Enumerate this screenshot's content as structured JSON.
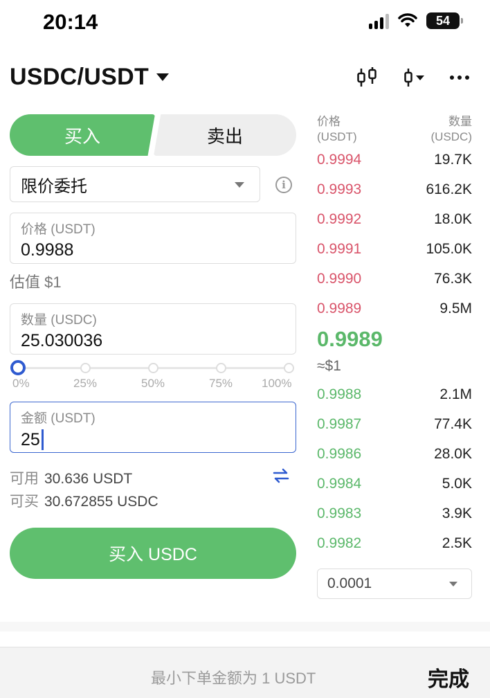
{
  "status_bar": {
    "time": "20:14",
    "battery": "54"
  },
  "header": {
    "pair": "USDC/USDT"
  },
  "tabs": {
    "buy": "买入",
    "sell": "卖出"
  },
  "order_type": {
    "value": "限价委托"
  },
  "price_field": {
    "label": "价格 (USDT)",
    "value": "0.9988",
    "estimate": "估值 $1"
  },
  "qty_field": {
    "label": "数量 (USDC)",
    "value": "25.030036"
  },
  "slider": {
    "value_percent": 0,
    "labels": [
      "0%",
      "25%",
      "50%",
      "75%",
      "100%"
    ]
  },
  "amount_field": {
    "label": "金额 (USDT)",
    "value": "25"
  },
  "available": {
    "usable_label": "可用",
    "usable_value": "30.636 USDT",
    "buyable_label": "可买",
    "buyable_value": "30.672855 USDC"
  },
  "buy_button": {
    "label": "买入 USDC"
  },
  "orderbook": {
    "price_header": "价格",
    "price_unit": "(USDT)",
    "qty_header": "数量",
    "qty_unit": "(USDC)",
    "asks": [
      {
        "price": "0.9994",
        "qty": "19.7K"
      },
      {
        "price": "0.9993",
        "qty": "616.2K"
      },
      {
        "price": "0.9992",
        "qty": "18.0K"
      },
      {
        "price": "0.9991",
        "qty": "105.0K"
      },
      {
        "price": "0.9990",
        "qty": "76.3K"
      },
      {
        "price": "0.9989",
        "qty": "9.5M"
      }
    ],
    "last_price": "0.9989",
    "last_usd": "≈$1",
    "bids": [
      {
        "price": "0.9988",
        "qty": "2.1M"
      },
      {
        "price": "0.9987",
        "qty": "77.4K"
      },
      {
        "price": "0.9986",
        "qty": "28.0K"
      },
      {
        "price": "0.9984",
        "qty": "5.0K"
      },
      {
        "price": "0.9983",
        "qty": "3.9K"
      },
      {
        "price": "0.9982",
        "qty": "2.5K"
      }
    ],
    "precision": "0.0001"
  },
  "bottom": {
    "min_note": "最小下单金额为 1 USDT",
    "done": "完成"
  },
  "colors": {
    "buy_green": "#5fbf6e",
    "ask_red": "#d9546a",
    "bid_green": "#5bb86a",
    "accent_blue": "#2f5bd0"
  }
}
